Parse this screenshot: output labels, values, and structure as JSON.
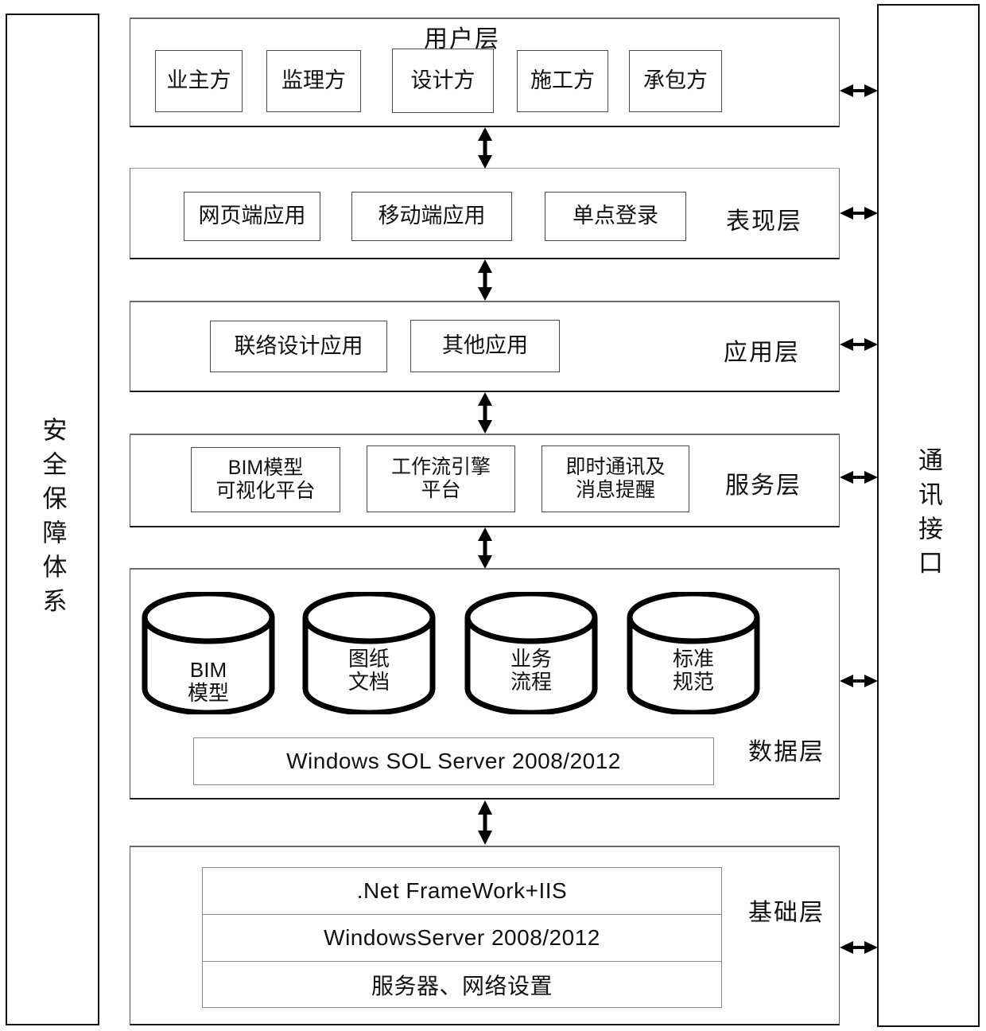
{
  "diagram": {
    "left_pillar": {
      "label": "安全保障体系"
    },
    "right_pillar": {
      "label": "通讯接口"
    },
    "layers": [
      {
        "id": "user",
        "title": "用户层",
        "title_position": "top-center",
        "items": [
          {
            "label": "业主方"
          },
          {
            "label": "监理方"
          },
          {
            "label": "设计方"
          },
          {
            "label": "施工方"
          },
          {
            "label": "承包方"
          }
        ]
      },
      {
        "id": "presentation",
        "title": "表现层",
        "title_position": "right",
        "items": [
          {
            "label": "网页端应用"
          },
          {
            "label": "移动端应用"
          },
          {
            "label": "单点登录"
          }
        ]
      },
      {
        "id": "application",
        "title": "应用层",
        "title_position": "right",
        "items": [
          {
            "label": "联络设计应用"
          },
          {
            "label": "其他应用"
          }
        ]
      },
      {
        "id": "service",
        "title": "服务层",
        "title_position": "right",
        "items": [
          {
            "line1": "BIM模型",
            "line2": "可视化平台"
          },
          {
            "line1": "工作流引擎",
            "line2": "平台"
          },
          {
            "line1": "即时通讯及",
            "line2": "消息提醒"
          }
        ]
      },
      {
        "id": "data",
        "title": "数据层",
        "title_position": "right",
        "cylinders": [
          {
            "line1": "BIM",
            "line2": "模型"
          },
          {
            "line1": "图纸",
            "line2": "文档"
          },
          {
            "line1": "业务",
            "line2": "流程"
          },
          {
            "line1": "标准",
            "line2": "规范"
          }
        ],
        "database_bar": "Windows  SOL  Server 2008/2012"
      },
      {
        "id": "foundation",
        "title": "基础层",
        "title_position": "right",
        "rows": [
          {
            "label": ".Net FrameWork+IIS"
          },
          {
            "label": "WindowsServer 2008/2012"
          },
          {
            "label": "服务器、网络设置"
          }
        ]
      }
    ],
    "connectors": {
      "vertical_arrow_name": "double-headed-vertical-arrow",
      "horizontal_arrow_name": "double-headed-horizontal-arrow",
      "vertical_count": 5,
      "horizontal_count": 6
    },
    "colors": {
      "stroke": "#111111",
      "inner_stroke": "#4a4a4a",
      "background": "#ffffff"
    }
  }
}
